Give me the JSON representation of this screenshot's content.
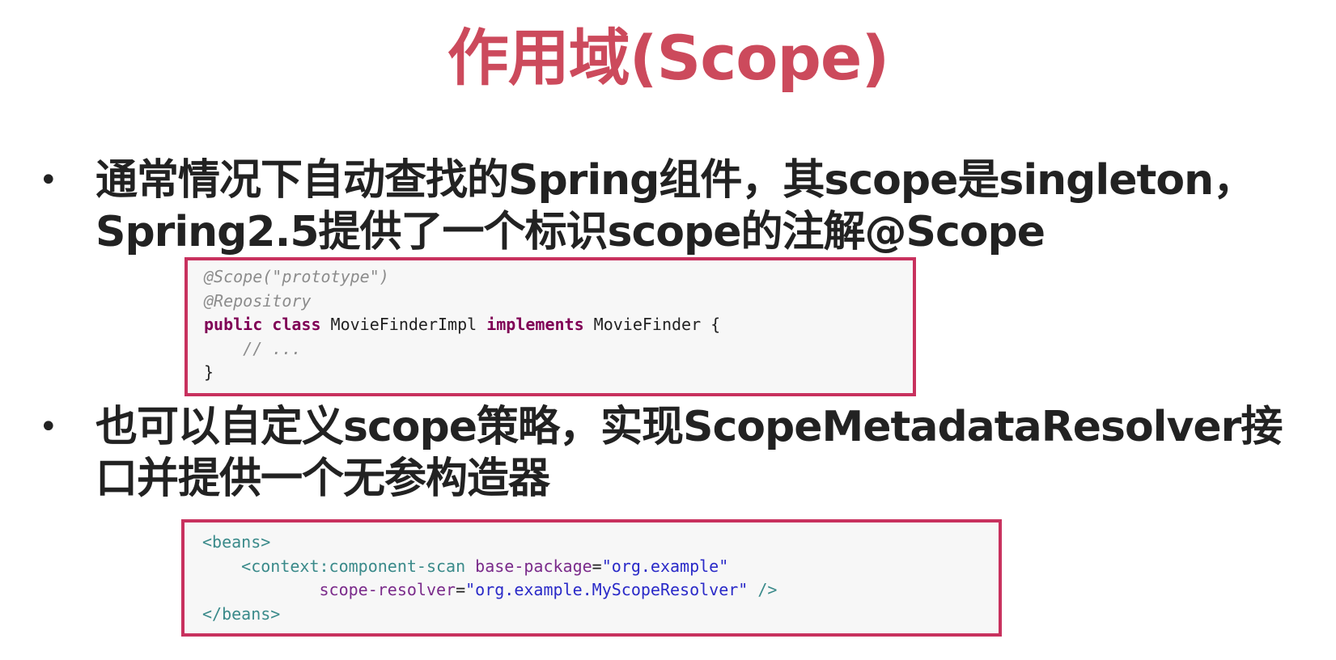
{
  "slide": {
    "title": "作用域(Scope)"
  },
  "bullets": [
    {
      "symbol": "•",
      "lines": [
        "通常情况下自动查找的Spring组件，其scope是singleton，",
        "Spring2.5提供了一个标识scope的注解@Scope"
      ]
    },
    {
      "symbol": "•",
      "lines": [
        "也可以自定义scope策略，实现ScopeMetadataResolver接",
        "口并提供一个无参构造器"
      ]
    }
  ],
  "code_java": {
    "line1": "@Scope(\"prototype\")",
    "line2": "@Repository",
    "line3_kw1": "public class",
    "line3_name": " MovieFinderImpl ",
    "line3_kw2": "implements",
    "line3_rest": " MovieFinder {",
    "line4": "    // ...",
    "line5": "}"
  },
  "code_xml": {
    "line1": "<beans>",
    "line2_indent": "    ",
    "line2_tag": "<context:component-scan",
    "line2_sp": " ",
    "line2_attr": "base-package",
    "line2_eq": "=",
    "line2_val": "\"org.example\"",
    "line3_indent": "            ",
    "line3_attr": "scope-resolver",
    "line3_eq": "=",
    "line3_val": "\"org.example.MyScopeResolver\"",
    "line3_close": " />",
    "line4": "</beans>"
  }
}
